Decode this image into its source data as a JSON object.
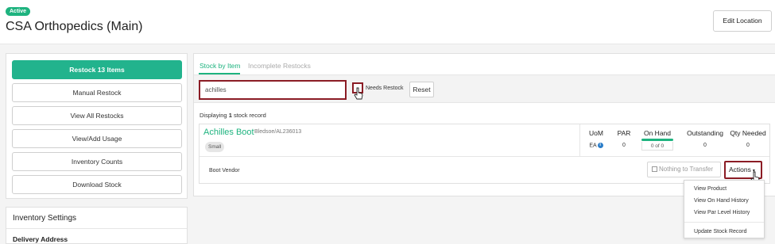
{
  "header": {
    "status_badge": "Active",
    "title": "CSA Orthopedics (Main)",
    "edit_location_label": "Edit Location"
  },
  "sidebar": {
    "buttons": [
      {
        "label": "Restock 13 Items",
        "primary": true
      },
      {
        "label": "Manual Restock"
      },
      {
        "label": "View All Restocks"
      },
      {
        "label": "View/Add Usage"
      },
      {
        "label": "Inventory Counts"
      },
      {
        "label": "Download Stock"
      }
    ]
  },
  "settings": {
    "title": "Inventory Settings",
    "item": "Delivery Address"
  },
  "tabs": [
    {
      "label": "Stock by Item",
      "active": true
    },
    {
      "label": "Incomplete Restocks",
      "active": false
    }
  ],
  "filters": {
    "search_value": "achilles",
    "needs_restock_label": "Needs Restock",
    "needs_restock_checked": false,
    "reset_label": "Reset"
  },
  "results": {
    "prefix": "Displaying ",
    "count": "1",
    "suffix": " stock record"
  },
  "record": {
    "name": "Achilles Boot",
    "sku": "Bledsoe/AL236013",
    "size": "Small",
    "columns": {
      "uom": {
        "header": "UoM",
        "value": "EA"
      },
      "par": {
        "header": "PAR",
        "value": "0"
      },
      "on_hand": {
        "header": "On Hand",
        "value": "0 of 0"
      },
      "outstanding": {
        "header": "Outstanding",
        "value": "0"
      },
      "qty_needed": {
        "header": "Qty Needed",
        "value": "0"
      }
    },
    "vendor": "Boot Vendor",
    "transfer_label": "Nothing to Transfer",
    "actions_label": "Actions"
  },
  "actions_menu": [
    "View Product",
    "View On Hand History",
    "View Par Level History",
    "Update Stock Record"
  ],
  "colors": {
    "accent": "#1eb37f",
    "highlight": "#8b1c25"
  }
}
